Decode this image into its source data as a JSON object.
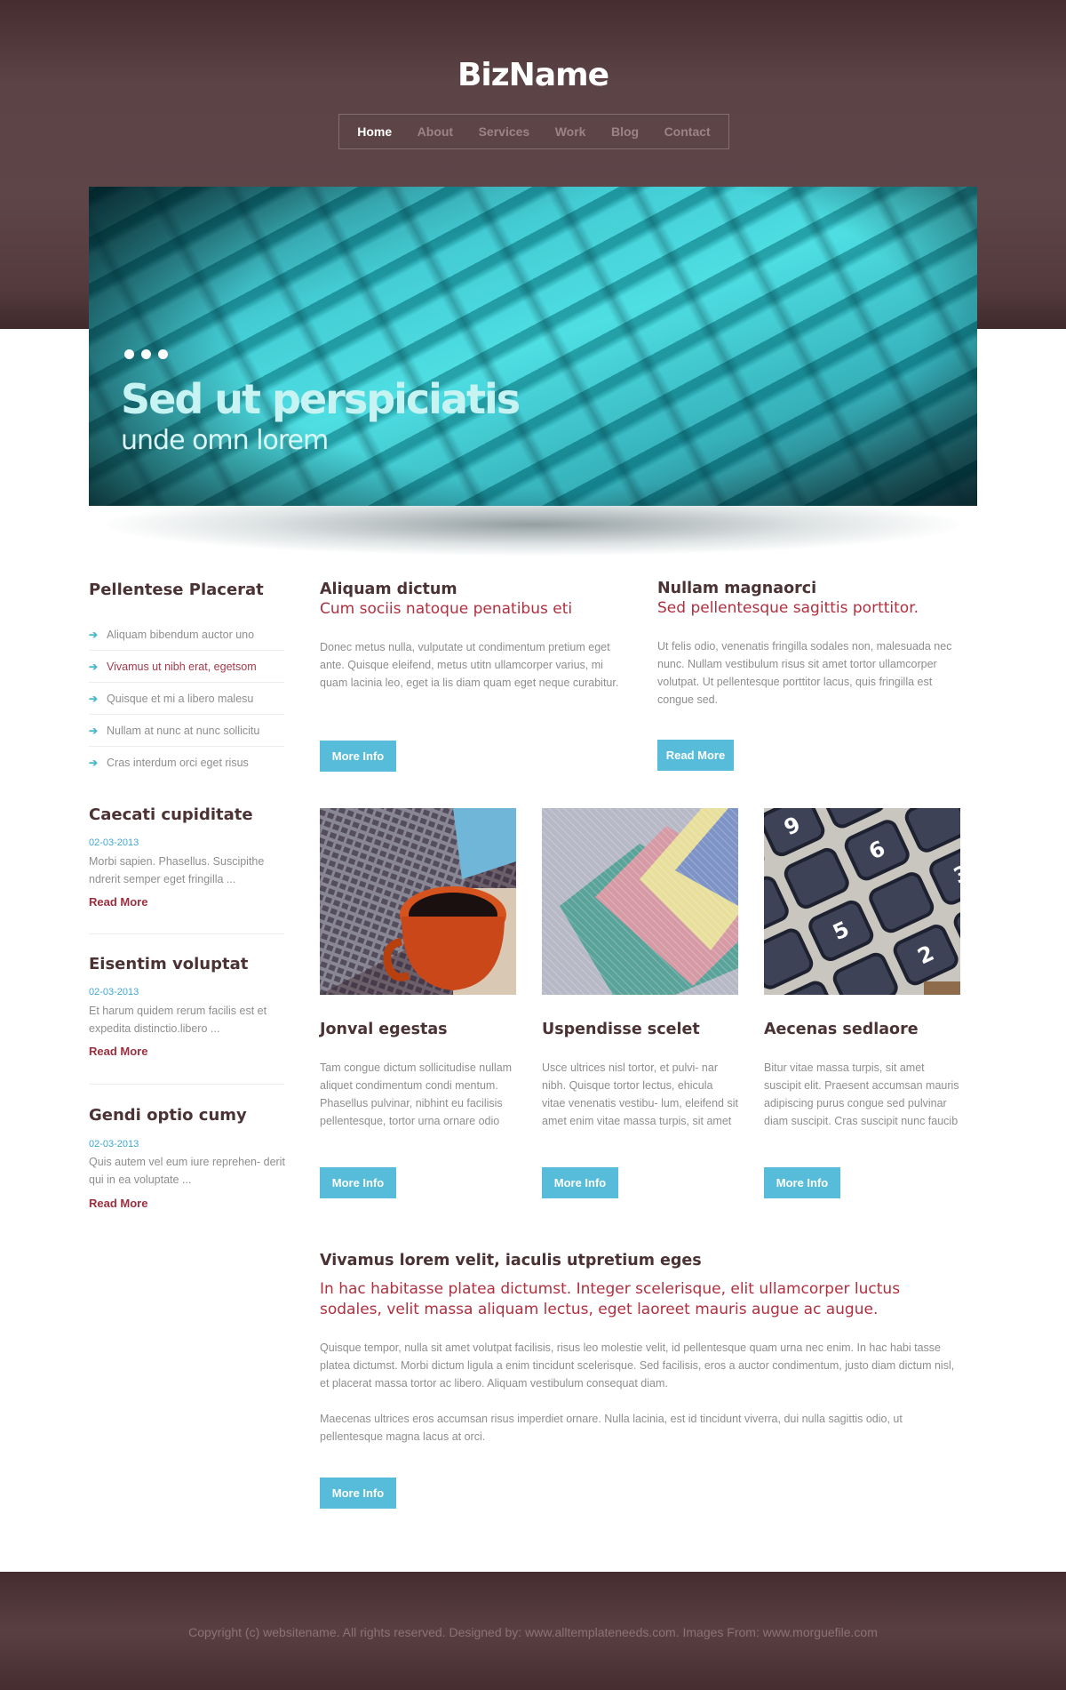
{
  "header": {
    "logo": "BizName"
  },
  "nav": {
    "items": [
      "Home",
      "About",
      "Services",
      "Work",
      "Blog",
      "Contact"
    ],
    "active": "Home"
  },
  "hero": {
    "title": "Sed ut perspiciatis",
    "subtitle": "unde omn lorem",
    "dot_count": 3
  },
  "sidebar": {
    "list_title": "Pellentese Placerat",
    "list_items": [
      "Aliquam bibendum auctor uno",
      "Vivamus ut nibh erat, egetsom",
      "Quisque et mi a libero malesu",
      "Nullam at nunc at nunc sollicitu",
      "Cras interdum orci eget risus"
    ],
    "posts": [
      {
        "title": "Caecati cupiditate",
        "date": "02-03-2013",
        "text": "Morbi sapien. Phasellus. Suscipithe ndrerit semper eget fringilla ...",
        "link": "Read More"
      },
      {
        "title": "Eisentim voluptat",
        "date": "02-03-2013",
        "text": "Et harum quidem rerum facilis est et expedita distinctio.libero ...",
        "link": "Read More"
      },
      {
        "title": "Gendi optio cumy",
        "date": "02-03-2013",
        "text": "Quis autem vel eum iure reprehen- derit qui in ea voluptate ...",
        "link": "Read More"
      }
    ]
  },
  "features": [
    {
      "title": "Aliquam dictum",
      "subtitle": "Cum sociis natoque penatibus eti",
      "text": "Donec metus nulla, vulputate ut condimentum  pretium eget ante. Quisque eleifend, metus utitn ullamcorper varius, mi quam lacinia leo, eget ia lis diam quam eget neque curabitur.",
      "button": "More Info"
    },
    {
      "title": "Nullam magnaorci",
      "subtitle": "Sed pellentesque sagittis porttitor.",
      "text": "Ut felis odio, venenatis fringilla sodales non, malesuada nec nunc. Nullam vestibulum risus sit amet tortor ullamcorper volutpat. Ut pellentesque porttitor lacus, quis fringilla est congue sed.",
      "button": "Read More"
    }
  ],
  "cards": [
    {
      "title": "Jonval egestas",
      "text": "Tam congue dictum sollicitudise nullam aliquet condimentum condi mentum. Phasellus pulvinar, nibhint eu facilisis pellentesque, tortor urna ornare odio",
      "button": "More Info",
      "image": "laptop-coffee-image"
    },
    {
      "title": "Uspendisse scelet",
      "text": "Usce ultrices nisl tortor, et pulvi- nar nibh. Quisque tortor lectus, ehicula vitae venenatis vestibu- lum, eleifend sit amet enim vitae massa turpis, sit amet",
      "button": "More Info",
      "image": "colored-paper-image"
    },
    {
      "title": "Aecenas sedlaore",
      "text": "Bitur vitae massa turpis, sit amet suscipit elit. Praesent accumsan mauris adipiscing purus congue sed pulvinar diam suscipit. Cras suscipit nunc faucib",
      "button": "More Info",
      "image": "calculator-image"
    }
  ],
  "article": {
    "title": "Vivamus lorem velit, iaculis utpretium eges",
    "subtitle": "In hac habitasse platea dictumst. Integer scelerisque, elit ullamcorper luctus sodales, velit massa aliquam lectus, eget laoreet mauris augue ac augue.",
    "para1": "Quisque tempor, nulla sit amet volutpat facilisis, risus leo molestie velit, id pellentesque quam urna nec enim. In hac habi tasse platea dictumst. Morbi dictum ligula a enim tincidunt scelerisque. Sed facilisis, eros a auctor condimentum, justo diam dictum nisl, et placerat massa tortor ac libero. Aliquam vestibulum consequat diam.",
    "para2": "Maecenas ultrices eros accumsan risus imperdiet ornare. Nulla lacinia, est id tincidunt viverra, dui nulla sagittis odio, ut pellentesque magna lacus at orci.",
    "button": "More Info"
  },
  "footer": {
    "text": "Copyright (c) websitename. All rights reserved. Designed by: www.alltemplateneeds.com.  Images From: www.morguefile.com"
  },
  "colors": {
    "brown": "#5e4548",
    "accent_blue": "#56bcd9",
    "accent_red": "#b0303f",
    "heading": "#4b3235"
  }
}
